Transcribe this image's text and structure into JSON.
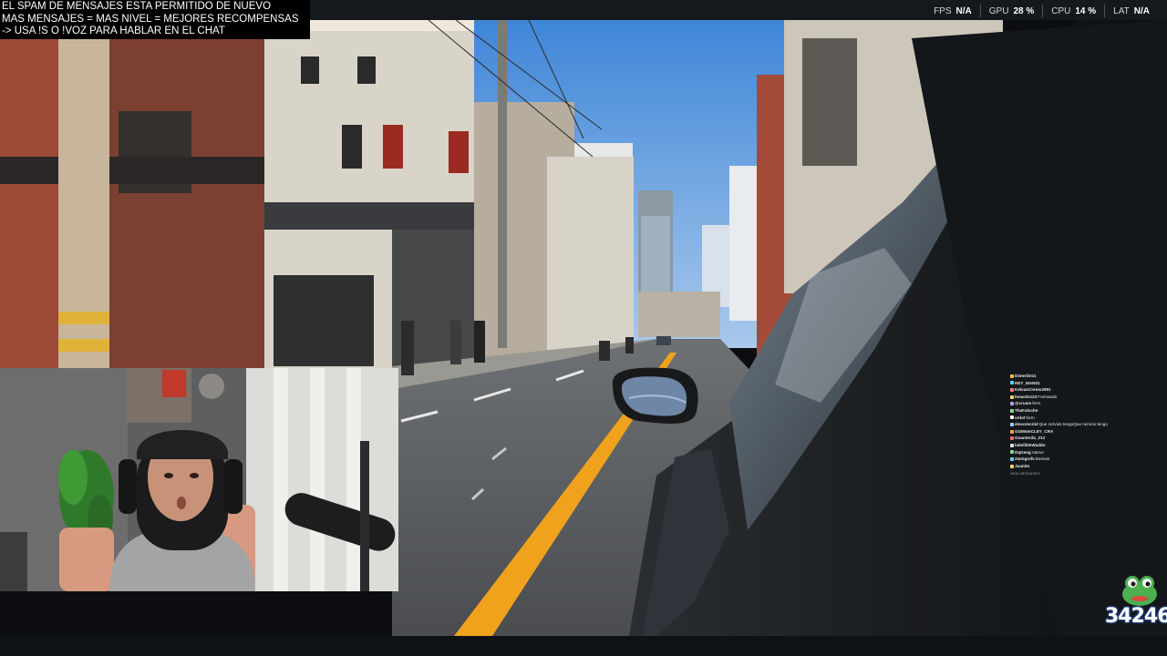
{
  "notice": {
    "line1": "EL SPAM DE MENSAJES ESTA PERMITIDO DE NUEVO",
    "line2": "MAS MENSAJES = MAS NIVEL = MEJORES RECOMPENSAS",
    "line3": "-> USA !S  O !VOZ PARA HABLAR EN EL CHAT"
  },
  "stats": [
    {
      "key": "FPS",
      "value": "N/A"
    },
    {
      "key": "GPU",
      "value": "28 %"
    },
    {
      "key": "CPU",
      "value": "14 %"
    },
    {
      "key": "LAT",
      "value": "N/A"
    }
  ],
  "chat": {
    "messages": [
      {
        "user": "Dimeribt11",
        "text": "",
        "color": "#f0c040"
      },
      {
        "user": "REY_MAN01",
        "text": "",
        "color": "#5fd3ff"
      },
      {
        "user": "KelvanCrems2991",
        "text": "",
        "color": "#ff7a7a"
      },
      {
        "user": "lenardo123",
        "text": "Formando",
        "color": "#ffd166"
      },
      {
        "user": "@crusm",
        "text": "form",
        "color": "#c39bff"
      },
      {
        "user": "ThaFalsche",
        "text": "",
        "color": "#7fe08a"
      },
      {
        "user": "xAlot",
        "text": "form",
        "color": "#ffffff"
      },
      {
        "user": "elexorecrist",
        "text": "Que nervios tengoQue nervios tengo",
        "color": "#9ad0ff"
      },
      {
        "user": "GGMsteCLEY_CRA",
        "text": "",
        "color": "#ff9f43"
      },
      {
        "user": "Goanterda_212",
        "text": "",
        "color": "#ff6b6b"
      },
      {
        "user": "labelibleWaddo",
        "text": "",
        "color": "#dddddd"
      },
      {
        "user": "DqGeng",
        "text": "Vamo!",
        "color": "#7fe08a"
      },
      {
        "user": "Zwmgrafs",
        "text": "Buenas",
        "color": "#5fd3ff"
      },
      {
        "user": "Juanito",
        "text": "",
        "color": "#ffd166"
      }
    ],
    "status": "NEW MESSAGES"
  },
  "counter": {
    "value": "34246"
  },
  "colors": {
    "sky": "#5ea1e0",
    "road": "#55585b",
    "lane_yellow": "#f0a21c",
    "topbar": "#15191d"
  }
}
